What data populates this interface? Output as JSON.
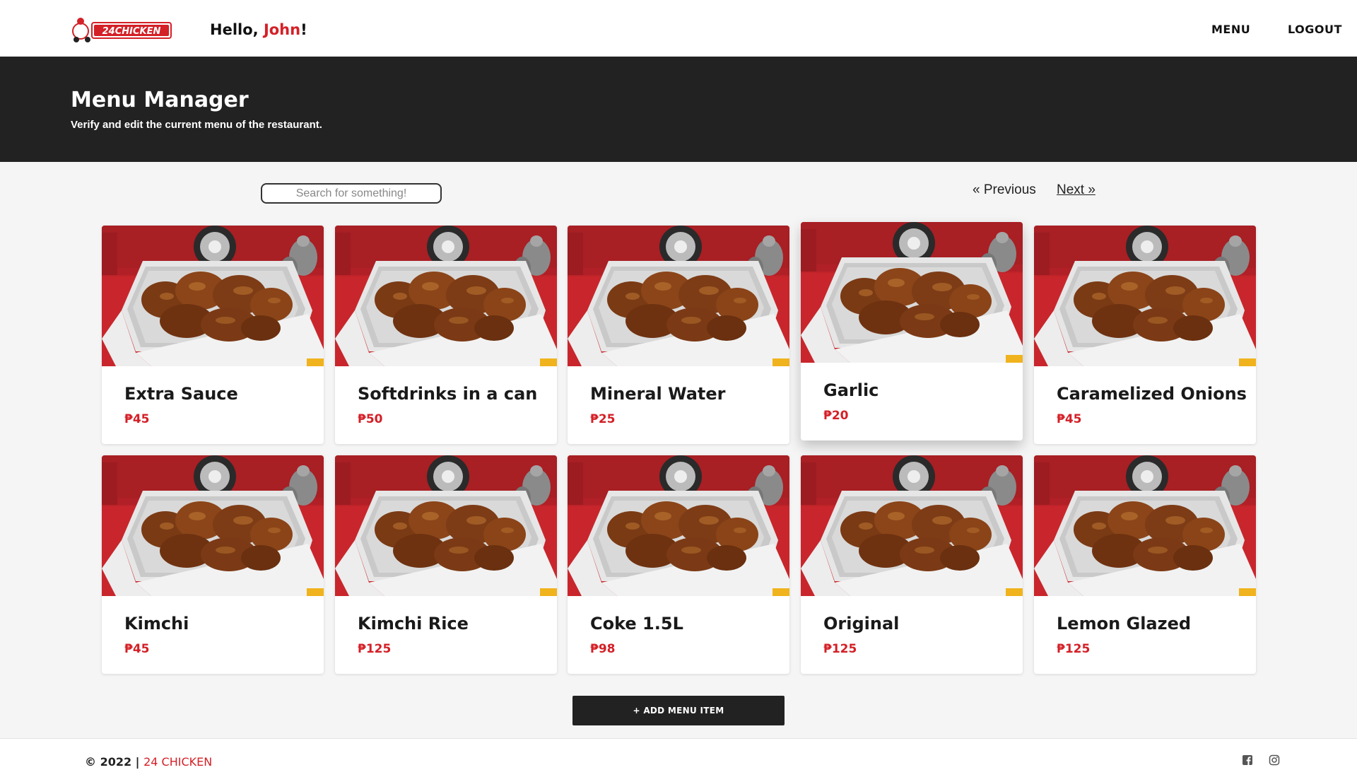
{
  "header": {
    "logo_text": "24CHICKEN",
    "greeting_prefix": "Hello, ",
    "user_name": "John",
    "greeting_suffix": "!",
    "nav": [
      {
        "label": "MENU"
      },
      {
        "label": "LOGOUT"
      }
    ]
  },
  "banner": {
    "title": "Menu Manager",
    "subtitle": "Verify and edit the current menu of the restaurant."
  },
  "search": {
    "placeholder": "Search for something!",
    "value": ""
  },
  "pagination": {
    "previous": "« Previous",
    "next": "Next »"
  },
  "menu_items": [
    {
      "name": "Extra Sauce",
      "price": "₱45"
    },
    {
      "name": "Softdrinks in a can",
      "price": "₱50"
    },
    {
      "name": "Mineral Water",
      "price": "₱25"
    },
    {
      "name": "Garlic",
      "price": "₱20"
    },
    {
      "name": "Caramelized Onions",
      "price": "₱45"
    },
    {
      "name": "Kimchi",
      "price": "₱45"
    },
    {
      "name": "Kimchi Rice",
      "price": "₱125"
    },
    {
      "name": "Coke 1.5L",
      "price": "₱98"
    },
    {
      "name": "Original",
      "price": "₱125"
    },
    {
      "name": "Lemon Glazed",
      "price": "₱125"
    }
  ],
  "add_button": {
    "label": "+ ADD MENU ITEM"
  },
  "footer": {
    "copyright": "© 2022 | ",
    "brand": "24 CHICKEN",
    "social": [
      {
        "icon": "facebook-icon"
      },
      {
        "icon": "instagram-icon"
      }
    ]
  },
  "colors": {
    "accent": "#d42027",
    "banner": "#222222",
    "background": "#f5f5f5"
  }
}
